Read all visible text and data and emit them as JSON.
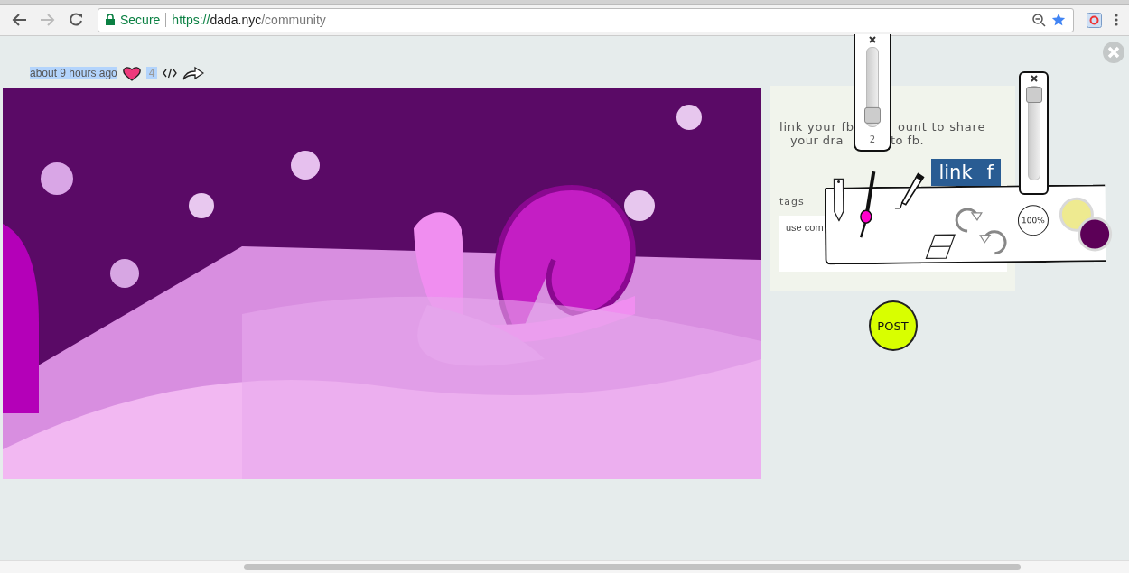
{
  "browser": {
    "security": "Secure",
    "url": {
      "scheme": "https://",
      "host": "dada.nyc",
      "path": "/community"
    }
  },
  "post_meta": {
    "time": "about 9 hours ago",
    "likes": "4"
  },
  "share_panel": {
    "description_lines": [
      [
        "link your fb",
        "ount to share"
      ],
      [
        "your dra",
        "to fb."
      ]
    ],
    "link_button": "link",
    "link_icon": "f",
    "tags_label": "tags",
    "tags_placeholder": "use com"
  },
  "toolbar": {
    "tools": [
      {
        "kind": "pencil",
        "selected": false
      },
      {
        "kind": "brush",
        "selected": true
      },
      {
        "kind": "pen",
        "selected": false
      },
      {
        "kind": "eraser",
        "selected": false
      },
      {
        "kind": "redo",
        "selected": false
      },
      {
        "kind": "undo",
        "selected": false
      }
    ],
    "zoom": "100%",
    "swatches": [
      {
        "color": "#eeea90"
      },
      {
        "color": "#5c0057"
      }
    ]
  },
  "sliders": [
    {
      "kind": "brush-size",
      "level": 0.05,
      "reading": "2"
    },
    {
      "kind": "opacity",
      "level": 1
    }
  ],
  "post_button": "POST"
}
